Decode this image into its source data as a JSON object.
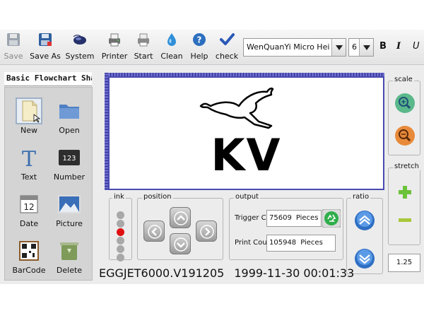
{
  "toolbar": {
    "buttons": [
      {
        "id": "save",
        "label": "Save",
        "icon": "floppy-icon",
        "enabled": false
      },
      {
        "id": "save_as",
        "label": "Save As",
        "icon": "floppy-save-as-icon",
        "enabled": true
      },
      {
        "id": "system",
        "label": "System",
        "icon": "mouse-icon",
        "enabled": true
      },
      {
        "id": "printer",
        "label": "Printer",
        "icon": "printer-icon",
        "enabled": true
      },
      {
        "id": "start",
        "label": "Start",
        "icon": "start-printer-icon",
        "enabled": true
      },
      {
        "id": "clean",
        "label": "Clean",
        "icon": "water-drop-icon",
        "enabled": true
      },
      {
        "id": "help",
        "label": "Help",
        "icon": "help-icon",
        "enabled": true
      },
      {
        "id": "check",
        "label": "check",
        "icon": "checkmark-icon",
        "enabled": true
      }
    ],
    "font_family": "WenQuanYi Micro Hei",
    "font_size": "6",
    "bold": "B",
    "italic": "I",
    "underline": "U"
  },
  "shapes_panel": {
    "title": "Basic Flowchart Shap",
    "items": [
      {
        "label": "New",
        "icon": "new-file-icon",
        "selected": true
      },
      {
        "label": "Open",
        "icon": "folder-icon",
        "selected": false
      },
      {
        "label": "Text",
        "icon": "text-icon",
        "selected": false
      },
      {
        "label": "Number",
        "icon": "number-icon",
        "selected": false
      },
      {
        "label": "Date",
        "icon": "calendar-icon",
        "selected": false
      },
      {
        "label": "Picture",
        "icon": "picture-icon",
        "selected": false
      },
      {
        "label": "BarCode",
        "icon": "barcode-icon",
        "selected": false
      },
      {
        "label": "Delete",
        "icon": "trash-icon",
        "selected": false
      }
    ]
  },
  "canvas": {
    "print_text": "KV",
    "logo": "kangaroo-logo"
  },
  "ink": {
    "title": "ink",
    "levels": 6,
    "active_index": 2,
    "active_color": "#e01010"
  },
  "position": {
    "title": "position"
  },
  "output": {
    "title": "output",
    "trigger_label": "Trigger C",
    "trigger_value": "75609",
    "trigger_unit": "Pieces",
    "print_label": "Print Cou",
    "print_value": "105948",
    "print_unit": "Pieces"
  },
  "ratio": {
    "title": "ratio"
  },
  "scale": {
    "title": "scale"
  },
  "stretch": {
    "title": "stretch",
    "value": "1.25"
  },
  "status": {
    "version": "EGGJET6000.V191205",
    "datetime": "1999-11-30 00:01:33"
  }
}
